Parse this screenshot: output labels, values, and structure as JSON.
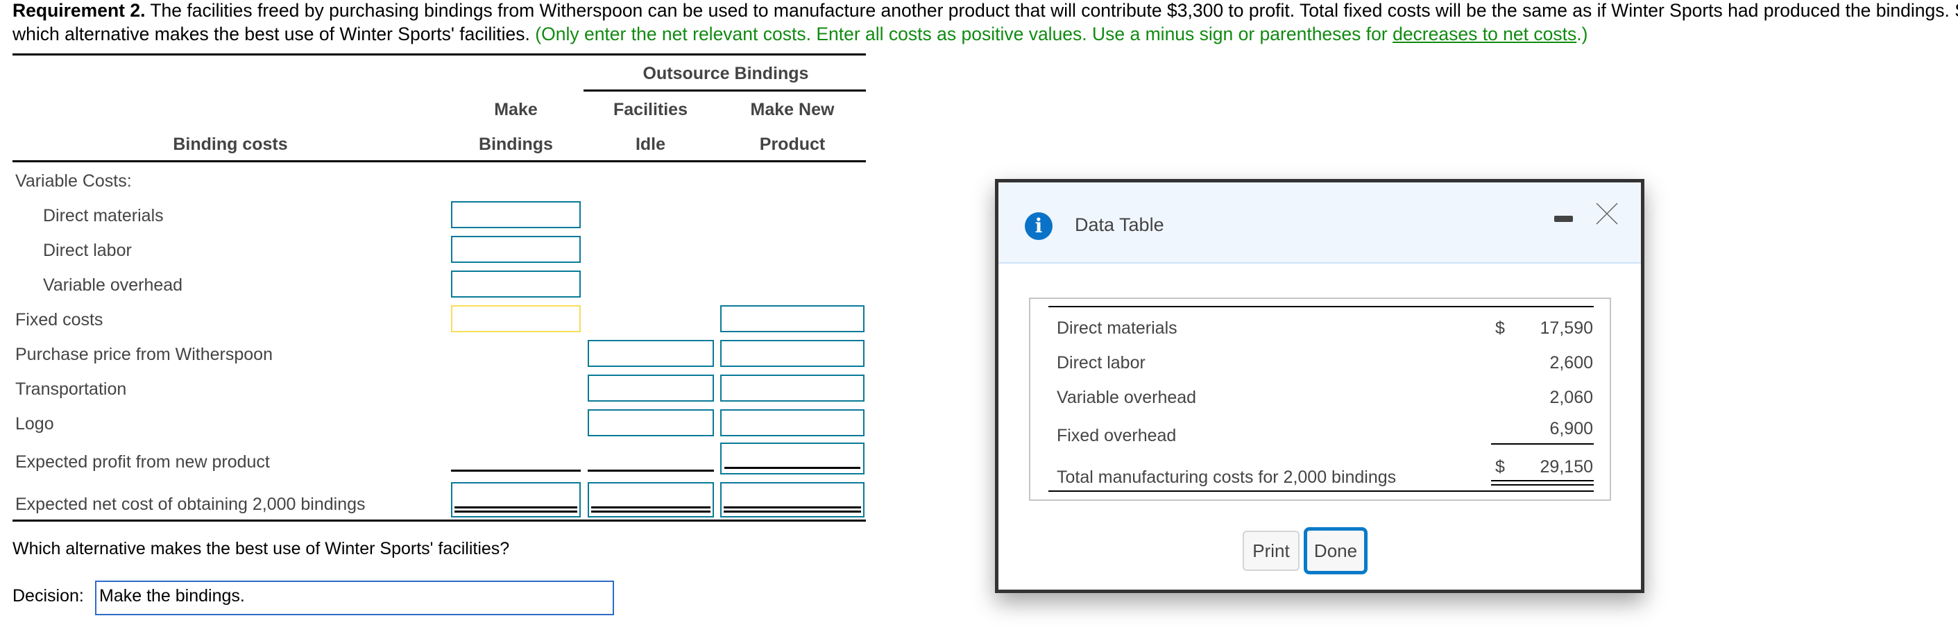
{
  "requirement": {
    "label": "Requirement 2.",
    "text_line1": " The facilities freed by purchasing bindings from Witherspoon can be used to manufacture another product that will contribute $3,300 to profit. Total fixed costs will be the same as if Winter Sports had produced the bindings. Show",
    "text_line2": "which alternative makes the best use of Winter Sports' facilities. ",
    "instruction_prefix": "(Only enter the net relevant costs. Enter all costs as positive values. Use a minus sign or parentheses for ",
    "instruction_link": "decreases to net costs",
    "instruction_suffix": ".)",
    "colors": {
      "instruction": "#118a11"
    }
  },
  "table": {
    "group_header": "Outsource Bindings",
    "row_header": "Binding costs",
    "columns": [
      {
        "line1": "Make",
        "line2": "Bindings"
      },
      {
        "line1": "Facilities",
        "line2": "Idle"
      },
      {
        "line1": "Make New",
        "line2": "Product"
      }
    ],
    "rows": [
      {
        "label": "Variable Costs:",
        "indent": false,
        "inputs": []
      },
      {
        "label": "Direct materials",
        "indent": true,
        "inputs": [
          "",
          null,
          null
        ]
      },
      {
        "label": "Direct labor",
        "indent": true,
        "inputs": [
          "",
          null,
          null
        ]
      },
      {
        "label": "Variable overhead",
        "indent": true,
        "inputs": [
          "",
          null,
          null
        ]
      },
      {
        "label": "Fixed costs",
        "indent": false,
        "inputs": [
          "",
          null,
          ""
        ]
      },
      {
        "label": "Purchase price from Witherspoon",
        "indent": false,
        "inputs": [
          null,
          "",
          ""
        ]
      },
      {
        "label": "Transportation",
        "indent": false,
        "inputs": [
          null,
          "",
          ""
        ]
      },
      {
        "label": "Logo",
        "indent": false,
        "inputs": [
          null,
          "",
          ""
        ]
      },
      {
        "label": "Expected profit from new product",
        "indent": false,
        "inputs": [
          null,
          null,
          ""
        ]
      },
      {
        "label": "Expected net cost of obtaining 2,000 bindings",
        "indent": false,
        "inputs": [
          "",
          "",
          ""
        ]
      }
    ],
    "colors": {
      "input_border": "#0a7a99",
      "active_input_border": "#f9dd59"
    }
  },
  "question": {
    "text": "Which alternative makes the best use of Winter Sports' facilities?",
    "decision_label": "Decision:",
    "decision_value": "Make the bindings."
  },
  "dialog": {
    "title": "Data Table",
    "icon": "info-icon",
    "minimize_icon": "minimize-icon",
    "close_icon": "close-icon",
    "rows": [
      {
        "label": "Direct materials",
        "currency": "$",
        "value": "17,590"
      },
      {
        "label": "Direct labor",
        "currency": "",
        "value": "2,600"
      },
      {
        "label": "Variable overhead",
        "currency": "",
        "value": "2,060"
      },
      {
        "label": "Fixed overhead",
        "currency": "",
        "value": "6,900"
      },
      {
        "label": "Total manufacturing costs for 2,000 bindings",
        "currency": "$",
        "value": "29,150"
      }
    ],
    "buttons": {
      "print": "Print",
      "done": "Done"
    },
    "colors": {
      "header_bg": "#f0f6fe",
      "info_icon": "#0a73c8",
      "done_focus": "#0a7ac9"
    }
  }
}
